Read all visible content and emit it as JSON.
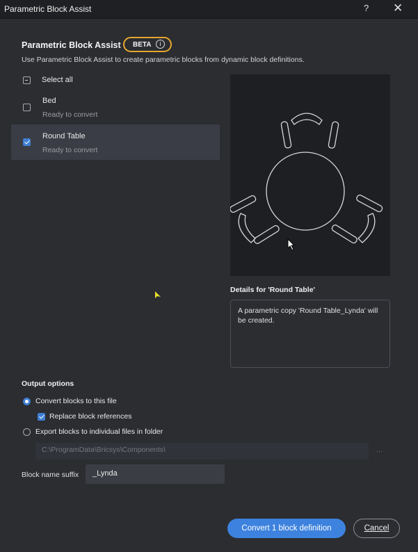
{
  "window": {
    "title": "Parametric Block Assist",
    "help": "?",
    "close": "✕"
  },
  "header": {
    "title": "Parametric Block Assist",
    "badge": "BETA",
    "badge_icon": "info-icon",
    "subtitle": "Use Parametric Block Assist to create parametric blocks from dynamic block definitions."
  },
  "blocks": {
    "select_all": "Select all",
    "items": [
      {
        "name": "Bed",
        "status": "Ready to convert",
        "checked": false
      },
      {
        "name": "Round Table",
        "status": "Ready to convert",
        "checked": true
      }
    ]
  },
  "details": {
    "title": "Details for 'Round Table'",
    "text": "A parametric copy 'Round Table_Lynda' will be created."
  },
  "output": {
    "title": "Output options",
    "convert_label": "Convert blocks to this file",
    "replace_label": "Replace block references",
    "export_label": "Export blocks to individual files in folder",
    "folder_path": "C:\\ProgramData\\Bricsys\\Components\\",
    "browse": "...",
    "suffix_label": "Block name suffix",
    "suffix_value": "_Lynda"
  },
  "buttons": {
    "convert": "Convert 1 block definition",
    "cancel": "Cancel"
  },
  "colors": {
    "accent": "#3d82de",
    "beta_border": "#e8a72d",
    "bg": "#2b2d31"
  }
}
